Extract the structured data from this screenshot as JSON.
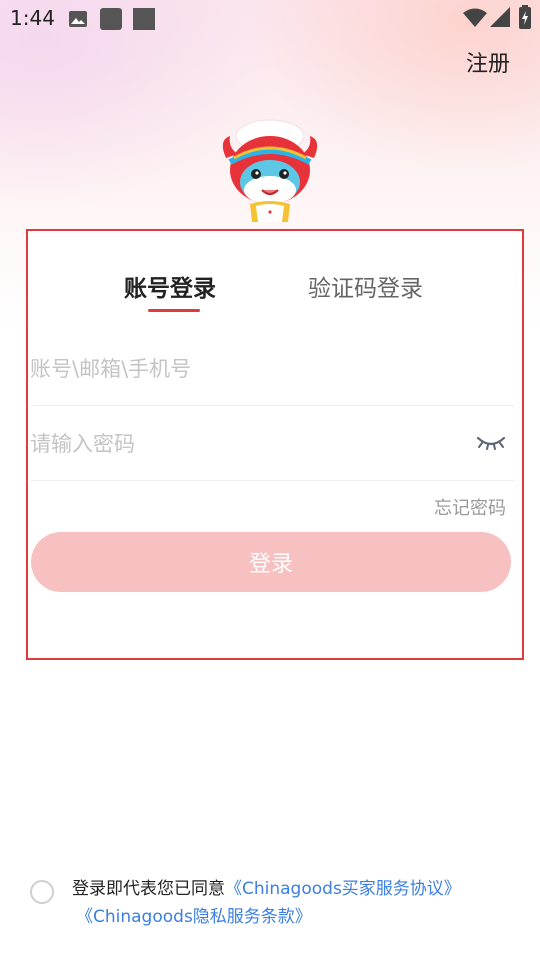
{
  "status_bar": {
    "time": "1:44",
    "icons": [
      "image-icon",
      "square-icon",
      "square-icon",
      "wifi-icon",
      "signal-icon",
      "battery-charging-icon"
    ]
  },
  "header": {
    "register_label": "注册"
  },
  "tabs": {
    "account_login": "账号登录",
    "code_login": "验证码登录",
    "active": "account_login"
  },
  "form": {
    "account_placeholder": "账号\\邮箱\\手机号",
    "account_value": "",
    "password_placeholder": "请输入密码",
    "password_value": "",
    "forgot_label": "忘记密码",
    "login_button": "登录"
  },
  "agreement": {
    "prefix": "登录即代表您已同意",
    "buyer_agreement": "《Chinagoods买家服务协议》",
    "privacy_terms": "《Chinagoods隐私服务条款》",
    "checked": false
  },
  "colors": {
    "accent": "#e23a3a",
    "button_disabled": "#f8c1c1",
    "link": "#3c7fe0"
  }
}
